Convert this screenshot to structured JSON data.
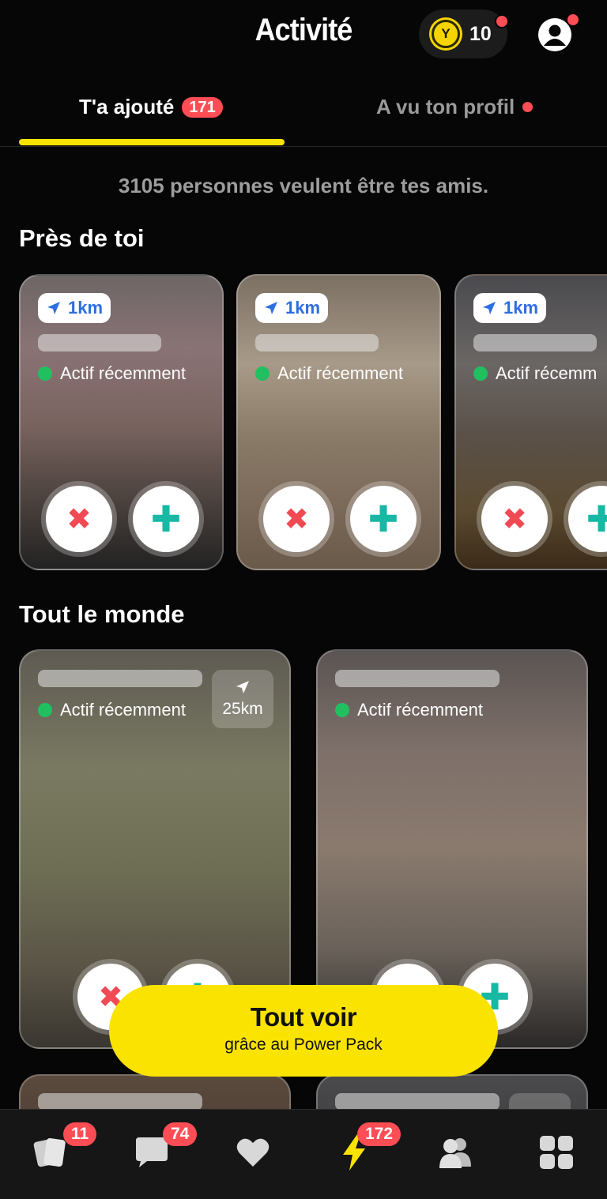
{
  "header": {
    "title": "Activité",
    "coin_symbol": "Y",
    "coins": "10"
  },
  "tabs": {
    "added_label": "T'a ajouté",
    "added_badge": "171",
    "viewed_label": "A vu ton profil"
  },
  "summary": "3105 personnes veulent être tes amis.",
  "nearby": {
    "title": "Près de toi",
    "cards": [
      {
        "distance": "1km",
        "status": "Actif récemment"
      },
      {
        "distance": "1km",
        "status": "Actif récemment"
      },
      {
        "distance": "1km",
        "status": "Actif récemm"
      }
    ]
  },
  "everyone": {
    "title": "Tout le monde",
    "cards": [
      {
        "status": "Actif récemment",
        "distance": "25km"
      },
      {
        "status": "Actif récemment"
      }
    ]
  },
  "cta": {
    "title": "Tout voir",
    "subtitle": "grâce au Power Pack"
  },
  "navbar": {
    "cards_badge": "11",
    "chat_badge": "74",
    "activity_badge": "172"
  },
  "colors": {
    "accent_yellow": "#fbe300",
    "badge_red": "#ff4d55",
    "active_green": "#20c060",
    "plus_teal": "#17b8a4",
    "cross_red": "#f04a55"
  }
}
